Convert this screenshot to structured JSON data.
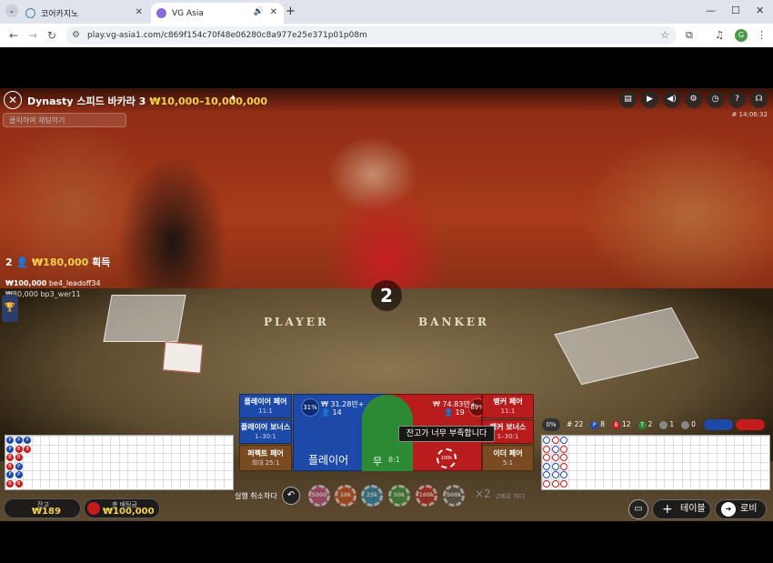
{
  "browser": {
    "tabs": [
      {
        "title": "코어카지노",
        "icon": "globe-icon",
        "close": "✕"
      },
      {
        "title": "VG Asia",
        "icon": "vg-icon",
        "audio": "🔊",
        "close": "✕"
      }
    ],
    "new_tab": "+",
    "window_controls": {
      "minimize": "—",
      "maximize": "☐",
      "close": "✕"
    },
    "url": "play.vg-asia1.com/c869f154c70f48e06280c8a977e25e371p01p08m",
    "profile_initial": "G"
  },
  "game": {
    "close": "✕",
    "table_name": "Dynasty 스피드 바카라 3",
    "limits": "₩10,000–10,000,000",
    "chat_placeholder": "클릭하여 채팅하기",
    "game_id": "# 14:06:32",
    "card_count": "2",
    "winners_count": "2",
    "winners_amount": "₩180,000",
    "winners_suffix": "획득",
    "winner_list": [
      {
        "amount": "₩100,000",
        "name": "be4_leadoff34"
      },
      {
        "amount": "₩80,000",
        "name": "bp3_wer11"
      }
    ],
    "felt": {
      "player": "PLAYER",
      "banker": "BANKER"
    },
    "side_bets_left": [
      {
        "name": "플레이어 페어",
        "odds": "11:1"
      },
      {
        "name": "플레이어 보너스",
        "odds": "1–30:1"
      },
      {
        "name": "퍼펙트 페어",
        "odds": "최대 25:1"
      }
    ],
    "side_bets_right": [
      {
        "name": "뱅커 페어",
        "odds": "11:1"
      },
      {
        "name": "뱅커 보너스",
        "odds": "1–30:1"
      },
      {
        "name": "이더 페어",
        "odds": "5:1"
      }
    ],
    "player_bet": {
      "label": "플레이어",
      "pct": "31%",
      "total": "₩ 31.28만+",
      "players": "14"
    },
    "banker_bet": {
      "pct": "69%",
      "total": "₩ 74.83만+",
      "players": "19"
    },
    "tie_bet": {
      "label": "무",
      "odds": "8:1"
    },
    "tooltip": "잔고가 너무 부족합니다",
    "stats": {
      "pct": "0%",
      "round": "# 22",
      "player": "8",
      "banker": "12",
      "tie": "2",
      "player_pair": "1",
      "banker_pair": "0",
      "p_letter": "P",
      "b_letter": "B",
      "t_letter": "T"
    },
    "undo_label": "실행 취소하다",
    "chips": [
      "5000",
      "10k",
      "25k",
      "50k",
      "100k",
      "500k"
    ],
    "double": "×2",
    "double_sub": "2배로 하다",
    "balance_label": "잔고",
    "balance": "₩189",
    "total_bet_label": "총 배팅금",
    "total_bet": "₩100,000",
    "tables_btn": "테이블",
    "lobby_btn": "로비",
    "road_left": [
      "P",
      "P",
      "B",
      "B",
      "P",
      "B",
      "P",
      "B",
      "B",
      "P",
      "P",
      "B",
      "P",
      "B"
    ],
    "road_right_marks": [
      "P",
      "B",
      "B",
      "P",
      "P",
      "B",
      "B",
      "P",
      "B",
      "P",
      "P",
      "B",
      "P",
      "B",
      "B",
      "B",
      "P",
      "B"
    ]
  }
}
